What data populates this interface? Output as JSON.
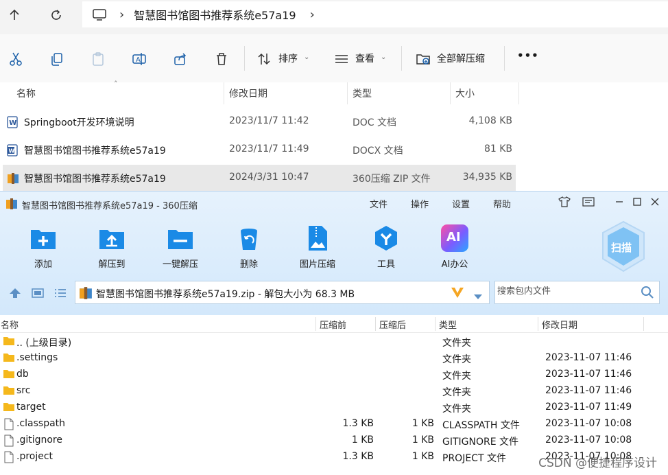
{
  "explorer": {
    "breadcrumb": "智慧图书馆图书推荐系统e57a19",
    "toolbar": {
      "sort_label": "排序",
      "view_label": "查看",
      "extract_all_label": "全部解压缩",
      "more_label": "•••"
    },
    "columns": [
      "名称",
      "修改日期",
      "类型",
      "大小"
    ],
    "files": [
      {
        "name": "Springboot开发环境说明",
        "date": "2023/11/7 11:42",
        "type": "DOC 文档",
        "size": "4,108 KB",
        "icon": "word-doc-icon"
      },
      {
        "name": "智慧图书馆图书推荐系统e57a19",
        "date": "2023/11/7 11:49",
        "type": "DOCX 文档",
        "size": "81 KB",
        "icon": "word-docx-icon"
      },
      {
        "name": "智慧图书馆图书推荐系统e57a19",
        "date": "2024/3/31 10:47",
        "type": "360压缩 ZIP 文件",
        "size": "34,935 KB",
        "icon": "zip-archive-icon",
        "selected": true
      }
    ]
  },
  "zip_window": {
    "title": "智慧图书馆图书推荐系统e57a19 - 360压缩",
    "menu": [
      "文件",
      "操作",
      "设置",
      "帮助"
    ],
    "tools": [
      {
        "label": "添加",
        "icon": "add-folder-icon"
      },
      {
        "label": "解压到",
        "icon": "extract-to-icon"
      },
      {
        "label": "一键解压",
        "icon": "one-click-extract-icon"
      },
      {
        "label": "删除",
        "icon": "delete-bin-icon"
      },
      {
        "label": "图片压缩",
        "icon": "image-compress-icon"
      },
      {
        "label": "工具",
        "icon": "tools-icon"
      },
      {
        "label": "AI办公",
        "icon": "ai-office-icon"
      }
    ],
    "scan_label": "扫描",
    "ai_badge": "AI",
    "path_text": "智慧图书馆图书推荐系统e57a19.zip - 解包大小为 68.3 MB",
    "search_placeholder": "搜索包内文件",
    "columns": [
      "名称",
      "压缩前",
      "压缩后",
      "类型",
      "修改日期"
    ],
    "rows": [
      {
        "name": ".. (上级目录)",
        "before": "",
        "after": "",
        "type": "文件夹",
        "date": "",
        "icon": "folder-icon"
      },
      {
        "name": ".settings",
        "before": "",
        "after": "",
        "type": "文件夹",
        "date": "2023-11-07 11:46",
        "icon": "folder-icon"
      },
      {
        "name": "db",
        "before": "",
        "after": "",
        "type": "文件夹",
        "date": "2023-11-07 11:46",
        "icon": "folder-icon"
      },
      {
        "name": "src",
        "before": "",
        "after": "",
        "type": "文件夹",
        "date": "2023-11-07 11:46",
        "icon": "folder-icon"
      },
      {
        "name": "target",
        "before": "",
        "after": "",
        "type": "文件夹",
        "date": "2023-11-07 11:49",
        "icon": "folder-icon"
      },
      {
        "name": ".classpath",
        "before": "1.3 KB",
        "after": "1 KB",
        "type": "CLASSPATH 文件",
        "date": "2023-11-07 10:08",
        "icon": "file-icon"
      },
      {
        "name": ".gitignore",
        "before": "1 KB",
        "after": "1 KB",
        "type": "GITIGNORE 文件",
        "date": "2023-11-07 10:08",
        "icon": "file-icon"
      },
      {
        "name": ".project",
        "before": "1.3 KB",
        "after": "1 KB",
        "type": "PROJECT 文件",
        "date": "2023-11-07 10:08",
        "icon": "file-icon"
      }
    ]
  },
  "watermark": "CSDN @便捷程序设计",
  "colors": {
    "accent": "#1a8ae6",
    "selected_row": "#e8e8e8",
    "zip_header": "#d3e8fb"
  }
}
